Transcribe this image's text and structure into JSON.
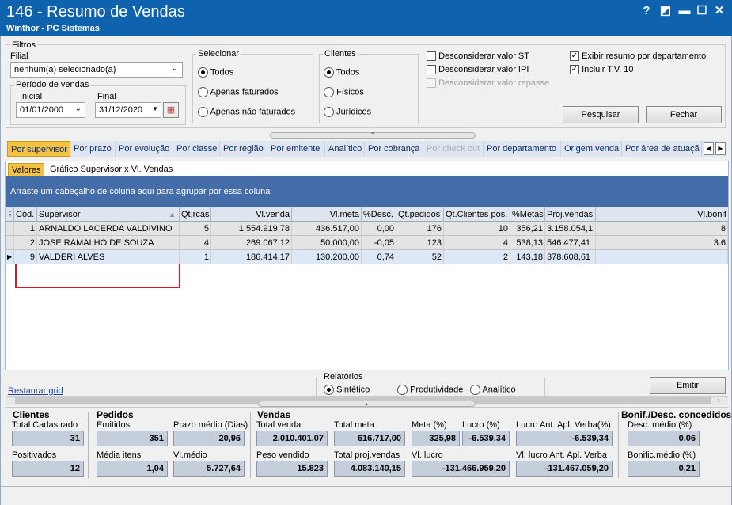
{
  "window": {
    "title": "146 - Resumo de Vendas",
    "subtitle": "Winthor - PC Sistemas",
    "help_label": "?",
    "restore_label": "◩",
    "minimize_label": "▬",
    "maximize_label": "☐",
    "close_label": "✕"
  },
  "filters": {
    "title": "Filtros",
    "filial_label": "Filial",
    "filial_value": "nenhum(a) selecionado(a)",
    "periodo_label": "Período de vendas",
    "inicial_label": "Inicial",
    "inicial_value": "01/01/2000",
    "final_label": "Final",
    "final_value": "31/12/2020"
  },
  "selecionar": {
    "title": "Selecionar",
    "options": [
      "Todos",
      "Apenas faturados",
      "Apenas não faturados"
    ],
    "selected": 0
  },
  "clientes": {
    "title": "Clientes",
    "options": [
      "Todos",
      "Físicos",
      "Jurídicos"
    ],
    "selected": 0
  },
  "checks": [
    {
      "label": "Desconsiderar valor ST",
      "checked": false,
      "enabled": true
    },
    {
      "label": "Desconsiderar valor IPI",
      "checked": false,
      "enabled": true
    },
    {
      "label": "Desconsiderar valor repasse",
      "checked": false,
      "enabled": false
    },
    {
      "label": "Exibir resumo por departamento",
      "checked": true,
      "enabled": true
    },
    {
      "label": "Incluir T.V. 10",
      "checked": true,
      "enabled": true
    }
  ],
  "buttons": {
    "pesquisar": "Pesquisar",
    "fechar": "Fechar",
    "emitir": "Emitir"
  },
  "tabs": [
    "Por supervisor",
    "Por prazo",
    "Por evolução",
    "Por classe",
    "Por região",
    "Por emitente",
    "Analítico",
    "Por cobrança",
    "Por check out",
    "Por departamento",
    "Origem venda",
    "Por área de atuaçã"
  ],
  "subtabs": [
    "Valores",
    "Gráfico Supervisor x Vl. Vendas"
  ],
  "grid": {
    "group_hint": "Arraste um cabeçalho de coluna aqui para agrupar por essa coluna",
    "columns": [
      "Cód.",
      "Supervisor",
      "Qt.rcas",
      "Vl.venda",
      "Vl.meta",
      "%Desc.",
      "Qt.pedidos",
      "Qt.Clientes pos.",
      "%Metas",
      "Proj.vendas",
      "Vl.bonif"
    ],
    "rows": [
      [
        "1",
        "ARNALDO LACERDA VALDIVINO",
        "5",
        "1.554.919,78",
        "436.517,00",
        "0,00",
        "176",
        "10",
        "356,21",
        "3.158.054,1",
        "8"
      ],
      [
        "2",
        "JOSE RAMALHO DE SOUZA",
        "4",
        "269.067,12",
        "50.000,00",
        "-0,05",
        "123",
        "4",
        "538,13",
        "546.477,41",
        "3.6"
      ],
      [
        "9",
        "VALDERI ALVES",
        "1",
        "186.414,17",
        "130.200,00",
        "0,74",
        "52",
        "2",
        "143,18",
        "378.608,61",
        ""
      ]
    ]
  },
  "relatorios": {
    "title": "Relatórios",
    "options": [
      "Sintético",
      "Produtividade",
      "Analítico"
    ],
    "selected": 0
  },
  "restaurar": "Restaurar grid",
  "summary": {
    "clientes": {
      "title": "Clientes",
      "total_cadastrado_label": "Total Cadastrado",
      "total_cadastrado": "31",
      "positivados_label": "Positivados",
      "positivados": "12"
    },
    "pedidos": {
      "title": "Pedidos",
      "emitidos_label": "Emitidos",
      "emitidos": "351",
      "prazo_label": "Prazo médio (Dias)",
      "prazo": "20,96",
      "media_itens_label": "Média itens",
      "media_itens": "1,04",
      "vlmedio_label": "Vl.médio",
      "vlmedio": "5.727,64"
    },
    "vendas": {
      "title": "Vendas",
      "total_venda_label": "Total venda",
      "total_venda": "2.010.401,07",
      "total_meta_label": "Total meta",
      "total_meta": "616.717,00",
      "meta_pct_label": "Meta (%)",
      "meta_pct": "325,98",
      "lucro_pct_label": "Lucro (%)",
      "lucro_pct": "-6.539,34",
      "lucro_ant_label": "Lucro Ant. Apl. Verba(%)",
      "lucro_ant": "-6.539,34",
      "peso_label": "Peso vendido",
      "peso": "15.823",
      "proj_label": "Total proj.vendas",
      "proj": "4.083.140,15",
      "vl_lucro_label": "Vl. lucro",
      "vl_lucro": "-131.466.959,20",
      "vl_lucro_ant_label": "Vl. lucro Ant. Apl. Verba",
      "vl_lucro_ant": "-131.467.059,20"
    },
    "bonif": {
      "title": "Bonif./Desc. concedidos",
      "desc_label": "Desc. médio (%)",
      "desc": "0,06",
      "bonif_label": "Bonific.médio (%)",
      "bonif": "0,21"
    }
  },
  "colors": {
    "titlebar": "#0f62ad",
    "group_header": "#436ca8",
    "highlight": "#e0141e",
    "active_tab": "#f5c242"
  }
}
